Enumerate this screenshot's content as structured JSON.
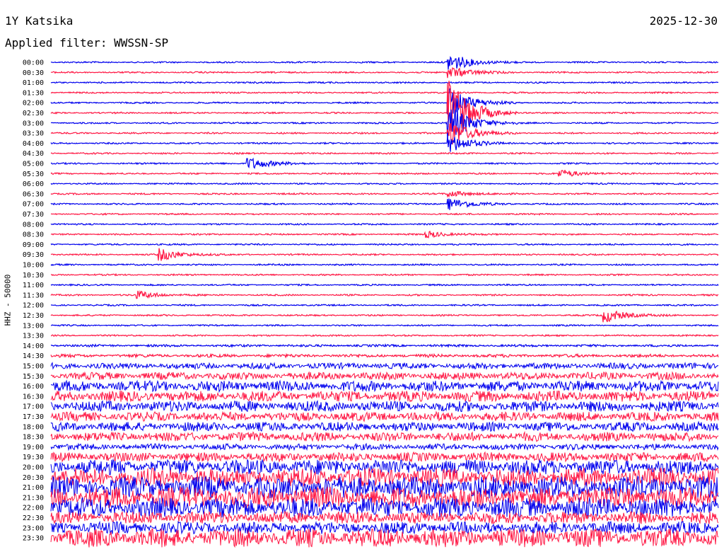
{
  "header": {
    "station": "1Y Katsika",
    "date": "2025-12-30",
    "filter": "Applied filter: WWSSN-SP",
    "channel": "HHZ - 50000"
  },
  "chart_data": {
    "type": "line",
    "colors": [
      "#0000ee",
      "#ff1744"
    ],
    "times": [
      "00:00",
      "00:30",
      "01:00",
      "01:30",
      "02:00",
      "02:30",
      "03:00",
      "03:30",
      "04:00",
      "04:30",
      "05:00",
      "05:30",
      "06:00",
      "06:30",
      "07:00",
      "07:30",
      "08:00",
      "08:30",
      "09:00",
      "09:30",
      "10:00",
      "10:30",
      "11:00",
      "11:30",
      "12:00",
      "12:30",
      "13:00",
      "13:30",
      "14:00",
      "14:30",
      "15:00",
      "15:30",
      "16:00",
      "16:30",
      "17:00",
      "17:30",
      "18:00",
      "18:30",
      "19:00",
      "19:30",
      "20:00",
      "20:30",
      "21:00",
      "21:30",
      "22:00",
      "22:30",
      "23:00",
      "23:30"
    ],
    "noise_level": [
      1,
      1,
      1,
      1,
      1,
      1,
      1,
      1,
      1,
      1,
      1,
      1,
      1,
      1,
      1,
      1,
      1,
      1,
      1,
      1,
      1,
      1,
      1,
      1,
      1,
      1,
      1,
      1,
      1.5,
      2,
      4,
      5,
      7,
      7,
      7,
      6,
      6,
      6,
      4,
      6,
      10,
      12,
      14,
      14,
      13,
      8,
      8,
      12
    ],
    "events": [
      {
        "row": 0,
        "minute": 18,
        "amp": 12
      },
      {
        "row": 1,
        "minute": 18,
        "amp": 8
      },
      {
        "row": 4,
        "minute": 18,
        "amp": 20
      },
      {
        "row": 5,
        "minute": 18,
        "amp": 45
      },
      {
        "row": 6,
        "minute": 18,
        "amp": 25
      },
      {
        "row": 7,
        "minute": 18,
        "amp": 18
      },
      {
        "row": 8,
        "minute": 18,
        "amp": 12
      },
      {
        "row": 10,
        "minute": 9,
        "amp": 8
      },
      {
        "row": 11,
        "minute": 23,
        "amp": 5
      },
      {
        "row": 13,
        "minute": 18,
        "amp": 4
      },
      {
        "row": 14,
        "minute": 18,
        "amp": 8
      },
      {
        "row": 17,
        "minute": 17,
        "amp": 4
      },
      {
        "row": 19,
        "minute": 5,
        "amp": 8
      },
      {
        "row": 23,
        "minute": 4,
        "amp": 5
      },
      {
        "row": 25,
        "minute": 25,
        "amp": 9
      }
    ]
  }
}
